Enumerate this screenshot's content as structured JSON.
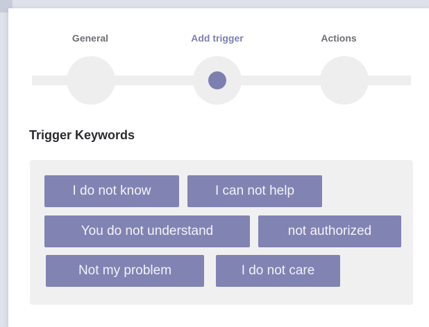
{
  "wizard": {
    "steps": [
      {
        "label": "General",
        "state": "inactive"
      },
      {
        "label": "Add trigger",
        "state": "active"
      },
      {
        "label": "Actions",
        "state": "inactive"
      }
    ],
    "active_step_index": 1
  },
  "section": {
    "title": "Trigger Keywords"
  },
  "keywords": [
    "I do not know",
    "I can not help",
    "You do not understand",
    "not authorized",
    "Not my problem",
    "I do not care"
  ],
  "colors": {
    "accent": "#7d7fb1",
    "chip_bg": "#8183b3",
    "panel_bg": "#f0f0f1",
    "track": "#eeeeef",
    "label_inactive": "#6f6f75",
    "title": "#2b2b2f"
  }
}
